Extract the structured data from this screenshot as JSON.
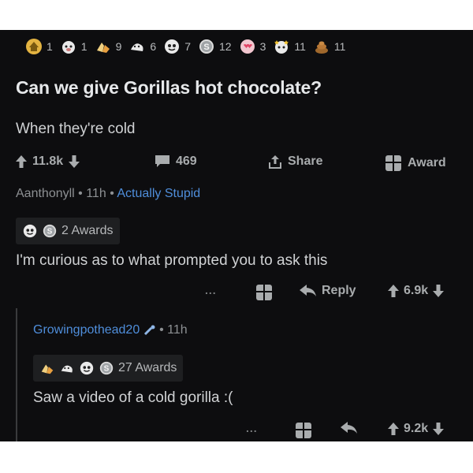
{
  "post": {
    "awards": [
      {
        "icon": "gold-house-award-icon",
        "count": "1"
      },
      {
        "icon": "pig-award-icon",
        "count": "1"
      },
      {
        "icon": "wholesome-hands-award-icon",
        "count": "9"
      },
      {
        "icon": "hugz-award-icon",
        "count": "6"
      },
      {
        "icon": "face-award-icon",
        "count": "7"
      },
      {
        "icon": "silver-coin-award-icon",
        "count": "12"
      },
      {
        "icon": "heart-eyes-award-icon",
        "count": "3"
      },
      {
        "icon": "starstruck-award-icon",
        "count": "11"
      },
      {
        "icon": "poop-award-icon",
        "count": "11"
      }
    ],
    "title": "Can we give Gorillas hot chocolate?",
    "body": "When they're cold",
    "upvotes": "11.8k",
    "comments": "469",
    "share_label": "Share",
    "award_label": "Award",
    "author": "Aanthonyll",
    "age": "11h",
    "flair": "Actually Stupid"
  },
  "comment1": {
    "awards_label": "2 Awards",
    "text": "I'm curious as to what prompted you to ask this",
    "more": "...",
    "reply_label": "Reply",
    "score": "6.9k"
  },
  "comment2": {
    "author": "Growingpothead20",
    "age": "11h",
    "awards_label": "27 Awards",
    "text": "Saw a video of a cold gorilla :(",
    "more": "...",
    "score": "9.2k"
  },
  "colors": {
    "background": "#0d0d0f",
    "text": "#d7dadc",
    "muted": "#8d9093",
    "flair_blue": "#4f8edb"
  }
}
